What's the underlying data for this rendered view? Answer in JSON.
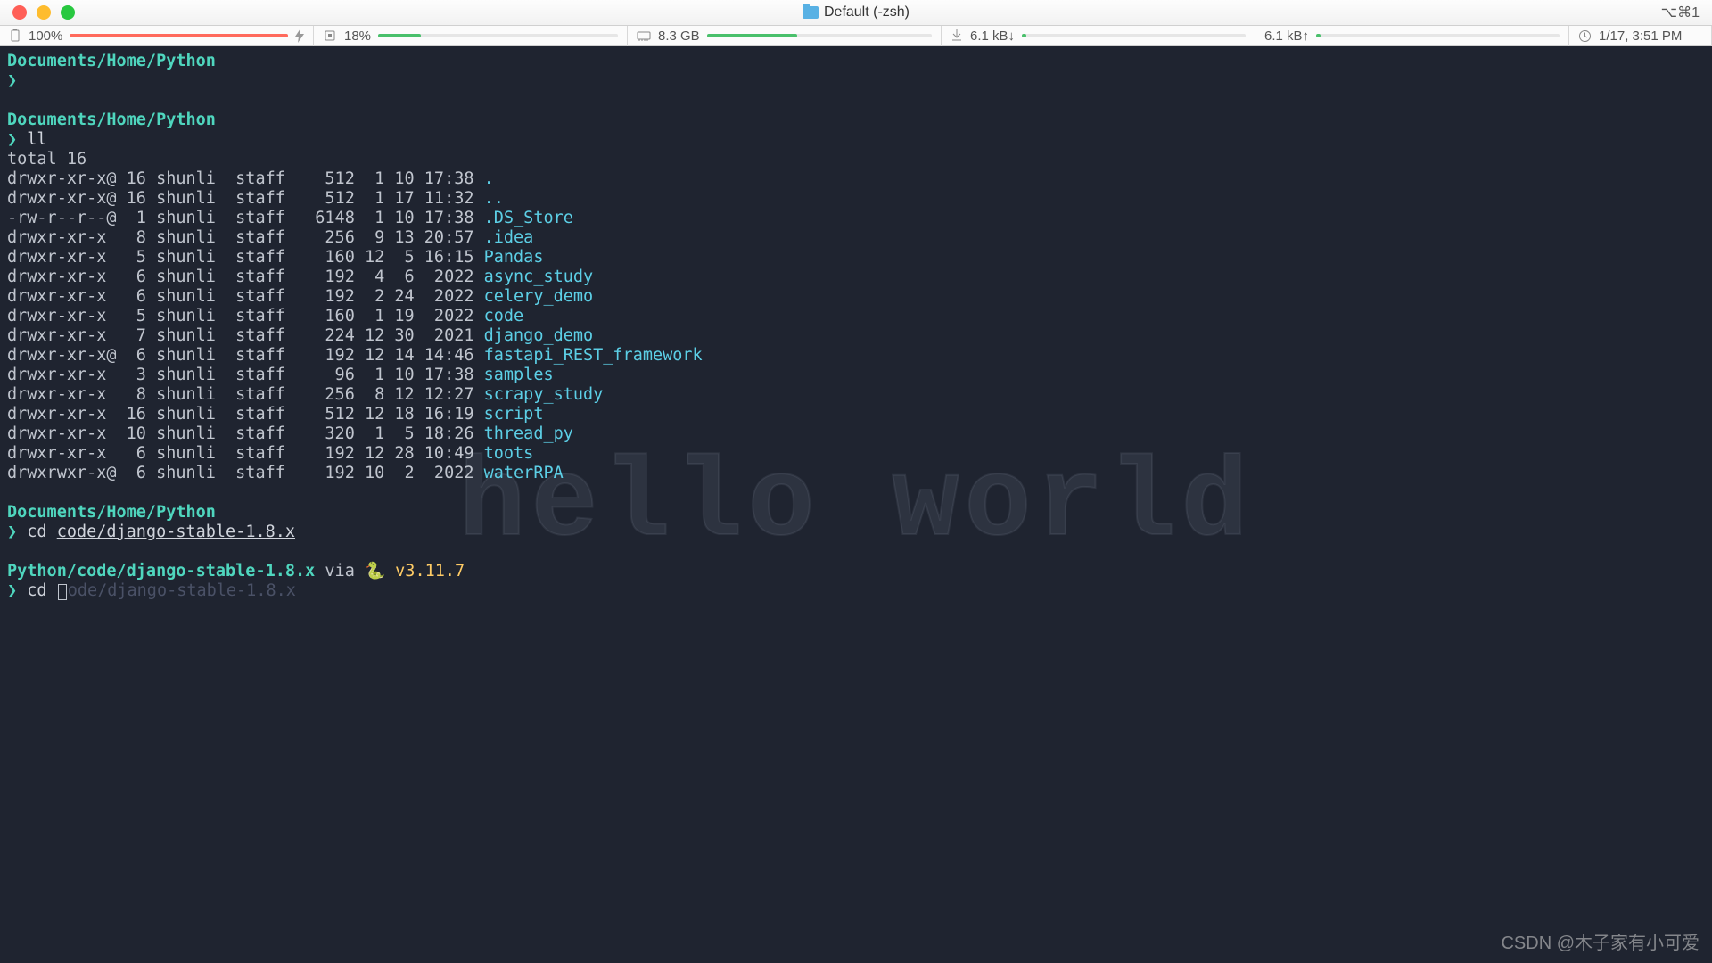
{
  "window": {
    "title": "Default (-zsh)",
    "shortcut": "⌥⌘1"
  },
  "status": {
    "battery": {
      "pct": "100%",
      "fill": 100,
      "color": "#ff6a5c"
    },
    "cpu": {
      "pct": "18%",
      "fill": 18,
      "color": "#49c06b"
    },
    "mem": {
      "val": "8.3 GB",
      "fill": 40,
      "color": "#49c06b"
    },
    "netdown": {
      "val": "6.1 kB↓",
      "fill": 2,
      "color": "#49c06b"
    },
    "netup": {
      "val": "6.1 kB↑",
      "fill": 2,
      "color": "#49c06b"
    },
    "clock": "1/17, 3:51 PM"
  },
  "terminal": {
    "hello": "hello world",
    "blocks": [
      {
        "path": "Documents/Home/Python",
        "cmd": ""
      },
      {
        "path": "Documents/Home/Python",
        "cmd": "ll"
      }
    ],
    "ll_total": "total 16",
    "ll": [
      {
        "perm": "drwxr-xr-x@",
        "n": "16",
        "u": "shunli",
        "g": "staff",
        "sz": "512",
        "m": "1",
        "d": "10",
        "t": "17:38",
        "name": "."
      },
      {
        "perm": "drwxr-xr-x@",
        "n": "16",
        "u": "shunli",
        "g": "staff",
        "sz": "512",
        "m": "1",
        "d": "17",
        "t": "11:32",
        "name": ".."
      },
      {
        "perm": "-rw-r--r--@",
        "n": "1",
        "u": "shunli",
        "g": "staff",
        "sz": "6148",
        "m": "1",
        "d": "10",
        "t": "17:38",
        "name": ".DS_Store"
      },
      {
        "perm": "drwxr-xr-x",
        "n": "8",
        "u": "shunli",
        "g": "staff",
        "sz": "256",
        "m": "9",
        "d": "13",
        "t": "20:57",
        "name": ".idea"
      },
      {
        "perm": "drwxr-xr-x",
        "n": "5",
        "u": "shunli",
        "g": "staff",
        "sz": "160",
        "m": "12",
        "d": "5",
        "t": "16:15",
        "name": "Pandas"
      },
      {
        "perm": "drwxr-xr-x",
        "n": "6",
        "u": "shunli",
        "g": "staff",
        "sz": "192",
        "m": "4",
        "d": "6",
        "t": "2022",
        "name": "async_study"
      },
      {
        "perm": "drwxr-xr-x",
        "n": "6",
        "u": "shunli",
        "g": "staff",
        "sz": "192",
        "m": "2",
        "d": "24",
        "t": "2022",
        "name": "celery_demo"
      },
      {
        "perm": "drwxr-xr-x",
        "n": "5",
        "u": "shunli",
        "g": "staff",
        "sz": "160",
        "m": "1",
        "d": "19",
        "t": "2022",
        "name": "code"
      },
      {
        "perm": "drwxr-xr-x",
        "n": "7",
        "u": "shunli",
        "g": "staff",
        "sz": "224",
        "m": "12",
        "d": "30",
        "t": "2021",
        "name": "django_demo"
      },
      {
        "perm": "drwxr-xr-x@",
        "n": "6",
        "u": "shunli",
        "g": "staff",
        "sz": "192",
        "m": "12",
        "d": "14",
        "t": "14:46",
        "name": "fastapi_REST_framework"
      },
      {
        "perm": "drwxr-xr-x",
        "n": "3",
        "u": "shunli",
        "g": "staff",
        "sz": "96",
        "m": "1",
        "d": "10",
        "t": "17:38",
        "name": "samples"
      },
      {
        "perm": "drwxr-xr-x",
        "n": "8",
        "u": "shunli",
        "g": "staff",
        "sz": "256",
        "m": "8",
        "d": "12",
        "t": "12:27",
        "name": "scrapy_study"
      },
      {
        "perm": "drwxr-xr-x",
        "n": "16",
        "u": "shunli",
        "g": "staff",
        "sz": "512",
        "m": "12",
        "d": "18",
        "t": "16:19",
        "name": "script"
      },
      {
        "perm": "drwxr-xr-x",
        "n": "10",
        "u": "shunli",
        "g": "staff",
        "sz": "320",
        "m": "1",
        "d": "5",
        "t": "18:26",
        "name": "thread_py"
      },
      {
        "perm": "drwxr-xr-x",
        "n": "6",
        "u": "shunli",
        "g": "staff",
        "sz": "192",
        "m": "12",
        "d": "28",
        "t": "10:49",
        "name": "toots"
      },
      {
        "perm": "drwxrwxr-x@",
        "n": "6",
        "u": "shunli",
        "g": "staff",
        "sz": "192",
        "m": "10",
        "d": "2",
        "t": "2022",
        "name": "waterRPA"
      }
    ],
    "block3": {
      "path": "Documents/Home/Python",
      "cmd": "cd ",
      "arg": "code/django-stable-1.8.x"
    },
    "block4": {
      "path": "Python/code/django-stable-1.8.x",
      "via": " via ",
      "snake": "🐍 ",
      "ver": "v3.11.7",
      "cmd": "cd ",
      "typed": "c",
      "suggest": "ode/django-stable-1.8.x"
    }
  },
  "footer": "CSDN @木子家有小可爱"
}
